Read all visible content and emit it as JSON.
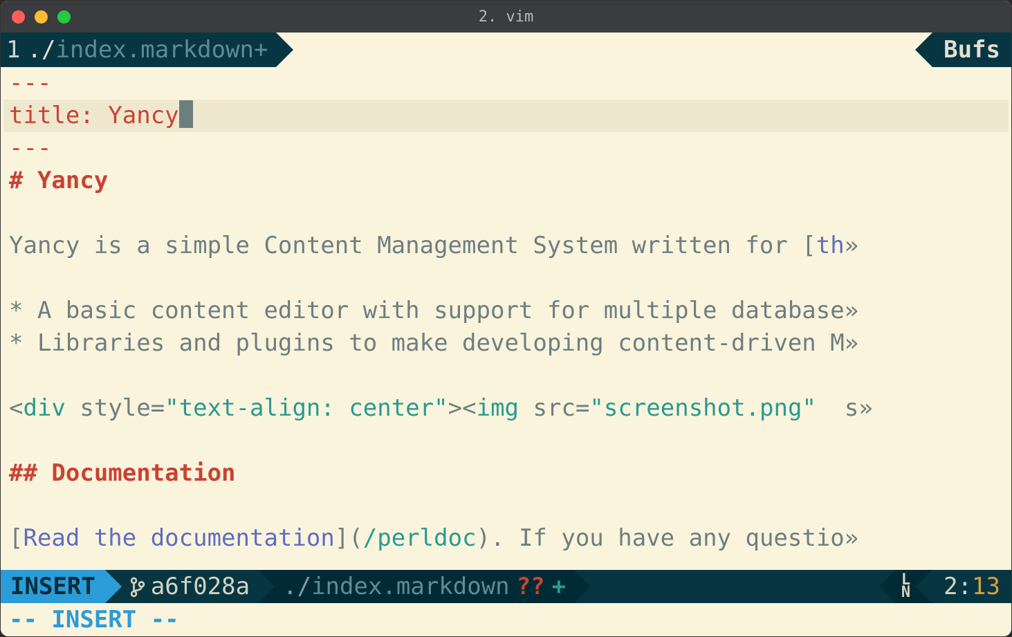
{
  "window": {
    "title": "2. vim"
  },
  "tabline": {
    "num": "1",
    "path_prefix": "./",
    "filename": "index.markdown+",
    "right_label": "Bufs"
  },
  "editor": {
    "lines": [
      {
        "type": "fence",
        "text": "---"
      },
      {
        "type": "cursor",
        "key": "title: ",
        "val": "Yancy"
      },
      {
        "type": "fence",
        "text": "---"
      },
      {
        "type": "heading",
        "text": "# Yancy"
      },
      {
        "type": "blank",
        "text": ""
      },
      {
        "type": "para_link",
        "pre": "Yancy is a simple Content Management System written for [",
        "link": "th",
        "wrap": "»"
      },
      {
        "type": "blank",
        "text": ""
      },
      {
        "type": "bullet",
        "text": "* A basic content editor with support for multiple database",
        "wrap": "»"
      },
      {
        "type": "bullet",
        "text": "* Libraries and plugins to make developing content-driven M",
        "wrap": "»"
      },
      {
        "type": "blank",
        "text": ""
      },
      {
        "type": "html",
        "parts": [
          {
            "t": "<",
            "c": "grey"
          },
          {
            "t": "div",
            "c": "teal"
          },
          {
            "t": " ",
            "c": "grey"
          },
          {
            "t": "style",
            "c": "grey"
          },
          {
            "t": "=",
            "c": "grey"
          },
          {
            "t": "\"text-align: center\"",
            "c": "teal"
          },
          {
            "t": "><",
            "c": "grey"
          },
          {
            "t": "img",
            "c": "teal"
          },
          {
            "t": " ",
            "c": "grey"
          },
          {
            "t": "src",
            "c": "grey"
          },
          {
            "t": "=",
            "c": "grey"
          },
          {
            "t": "\"screenshot.png\"",
            "c": "teal"
          },
          {
            "t": "  s",
            "c": "grey"
          }
        ],
        "wrap": "»"
      },
      {
        "type": "blank",
        "text": ""
      },
      {
        "type": "heading",
        "text": "## Documentation"
      },
      {
        "type": "blank",
        "text": ""
      },
      {
        "type": "link_line",
        "parts": [
          {
            "t": "[",
            "c": "grey"
          },
          {
            "t": "Read the documentation",
            "c": "blue"
          },
          {
            "t": "](",
            "c": "grey"
          },
          {
            "t": "/perldoc",
            "c": "teal"
          },
          {
            "t": "). If you have any questio",
            "c": "grey"
          }
        ],
        "wrap": "»"
      }
    ]
  },
  "statusline": {
    "mode": "INSERT",
    "git_commit": "a6f028a",
    "file_path_prefix": "./",
    "file_name": "index.markdown",
    "git_status": "??",
    "modified": "+",
    "ln_label_top": "L",
    "ln_label_bot": "N",
    "line": "2",
    "col": "13"
  },
  "cmdline": {
    "text": "-- INSERT --"
  }
}
